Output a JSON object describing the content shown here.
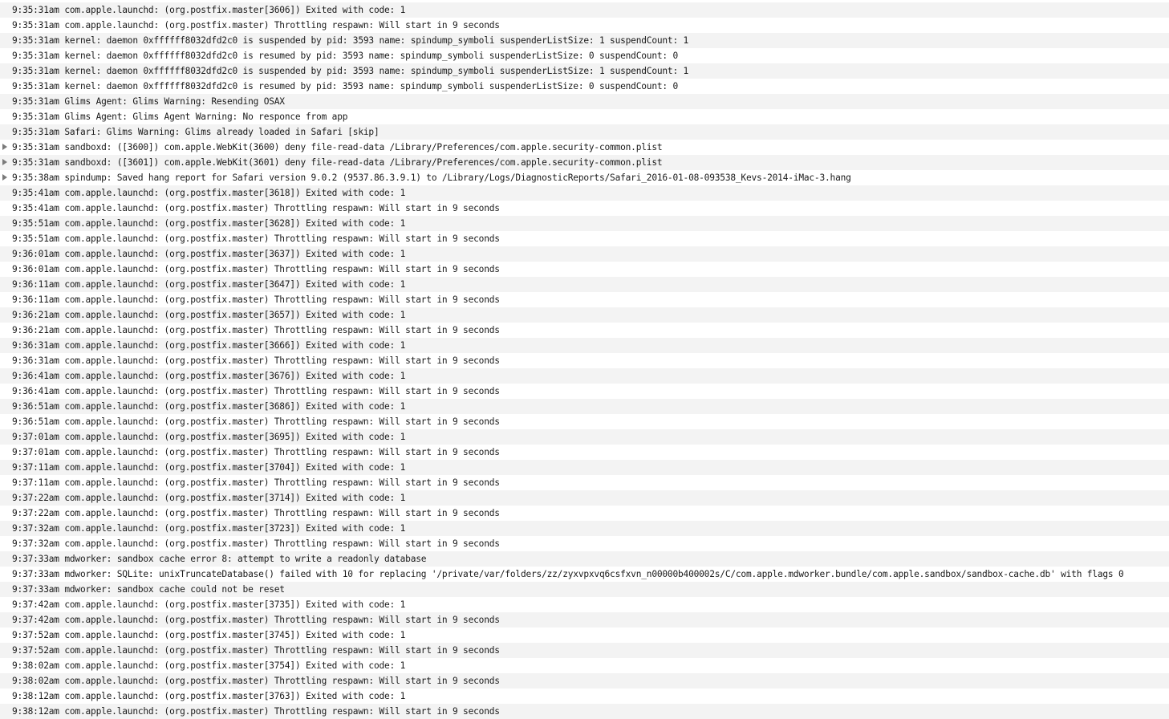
{
  "log_lines": [
    {
      "text": "9:35:31am com.apple.launchd: (org.postfix.master[3606]) Exited with code: 1",
      "expandable": false
    },
    {
      "text": "9:35:31am com.apple.launchd: (org.postfix.master) Throttling respawn: Will start in 9 seconds",
      "expandable": false
    },
    {
      "text": "9:35:31am kernel: daemon 0xffffff8032dfd2c0 is suspended by pid: 3593 name: spindump_symboli suspenderListSize: 1 suspendCount: 1",
      "expandable": false
    },
    {
      "text": "9:35:31am kernel: daemon 0xffffff8032dfd2c0 is resumed by pid: 3593 name: spindump_symboli suspenderListSize: 0 suspendCount: 0",
      "expandable": false
    },
    {
      "text": "9:35:31am kernel: daemon 0xffffff8032dfd2c0 is suspended by pid: 3593 name: spindump_symboli suspenderListSize: 1 suspendCount: 1",
      "expandable": false
    },
    {
      "text": "9:35:31am kernel: daemon 0xffffff8032dfd2c0 is resumed by pid: 3593 name: spindump_symboli suspenderListSize: 0 suspendCount: 0",
      "expandable": false
    },
    {
      "text": "9:35:31am Glims Agent: Glims Warning: Resending OSAX",
      "expandable": false
    },
    {
      "text": "9:35:31am Glims Agent: Glims Agent Warning: No responce from app",
      "expandable": false
    },
    {
      "text": "9:35:31am Safari: Glims Warning: Glims already loaded in Safari [skip]",
      "expandable": false
    },
    {
      "text": "9:35:31am sandboxd: ([3600]) com.apple.WebKit(3600) deny file-read-data /Library/Preferences/com.apple.security-common.plist",
      "expandable": true
    },
    {
      "text": "9:35:31am sandboxd: ([3601]) com.apple.WebKit(3601) deny file-read-data /Library/Preferences/com.apple.security-common.plist",
      "expandable": true
    },
    {
      "text": "9:35:38am spindump: Saved hang report for Safari version 9.0.2 (9537.86.3.9.1) to /Library/Logs/DiagnosticReports/Safari_2016-01-08-093538_Kevs-2014-iMac-3.hang",
      "expandable": true
    },
    {
      "text": "9:35:41am com.apple.launchd: (org.postfix.master[3618]) Exited with code: 1",
      "expandable": false
    },
    {
      "text": "9:35:41am com.apple.launchd: (org.postfix.master) Throttling respawn: Will start in 9 seconds",
      "expandable": false
    },
    {
      "text": "9:35:51am com.apple.launchd: (org.postfix.master[3628]) Exited with code: 1",
      "expandable": false
    },
    {
      "text": "9:35:51am com.apple.launchd: (org.postfix.master) Throttling respawn: Will start in 9 seconds",
      "expandable": false
    },
    {
      "text": "9:36:01am com.apple.launchd: (org.postfix.master[3637]) Exited with code: 1",
      "expandable": false
    },
    {
      "text": "9:36:01am com.apple.launchd: (org.postfix.master) Throttling respawn: Will start in 9 seconds",
      "expandable": false
    },
    {
      "text": "9:36:11am com.apple.launchd: (org.postfix.master[3647]) Exited with code: 1",
      "expandable": false
    },
    {
      "text": "9:36:11am com.apple.launchd: (org.postfix.master) Throttling respawn: Will start in 9 seconds",
      "expandable": false
    },
    {
      "text": "9:36:21am com.apple.launchd: (org.postfix.master[3657]) Exited with code: 1",
      "expandable": false
    },
    {
      "text": "9:36:21am com.apple.launchd: (org.postfix.master) Throttling respawn: Will start in 9 seconds",
      "expandable": false
    },
    {
      "text": "9:36:31am com.apple.launchd: (org.postfix.master[3666]) Exited with code: 1",
      "expandable": false
    },
    {
      "text": "9:36:31am com.apple.launchd: (org.postfix.master) Throttling respawn: Will start in 9 seconds",
      "expandable": false
    },
    {
      "text": "9:36:41am com.apple.launchd: (org.postfix.master[3676]) Exited with code: 1",
      "expandable": false
    },
    {
      "text": "9:36:41am com.apple.launchd: (org.postfix.master) Throttling respawn: Will start in 9 seconds",
      "expandable": false
    },
    {
      "text": "9:36:51am com.apple.launchd: (org.postfix.master[3686]) Exited with code: 1",
      "expandable": false
    },
    {
      "text": "9:36:51am com.apple.launchd: (org.postfix.master) Throttling respawn: Will start in 9 seconds",
      "expandable": false
    },
    {
      "text": "9:37:01am com.apple.launchd: (org.postfix.master[3695]) Exited with code: 1",
      "expandable": false
    },
    {
      "text": "9:37:01am com.apple.launchd: (org.postfix.master) Throttling respawn: Will start in 9 seconds",
      "expandable": false
    },
    {
      "text": "9:37:11am com.apple.launchd: (org.postfix.master[3704]) Exited with code: 1",
      "expandable": false
    },
    {
      "text": "9:37:11am com.apple.launchd: (org.postfix.master) Throttling respawn: Will start in 9 seconds",
      "expandable": false
    },
    {
      "text": "9:37:22am com.apple.launchd: (org.postfix.master[3714]) Exited with code: 1",
      "expandable": false
    },
    {
      "text": "9:37:22am com.apple.launchd: (org.postfix.master) Throttling respawn: Will start in 9 seconds",
      "expandable": false
    },
    {
      "text": "9:37:32am com.apple.launchd: (org.postfix.master[3723]) Exited with code: 1",
      "expandable": false
    },
    {
      "text": "9:37:32am com.apple.launchd: (org.postfix.master) Throttling respawn: Will start in 9 seconds",
      "expandable": false
    },
    {
      "text": "9:37:33am mdworker: sandbox cache error 8: attempt to write a readonly database",
      "expandable": false
    },
    {
      "text": "9:37:33am mdworker: SQLite: unixTruncateDatabase() failed with 10 for replacing '/private/var/folders/zz/zyxvpxvq6csfxvn_n00000b400002s/C/com.apple.mdworker.bundle/com.apple.sandbox/sandbox-cache.db' with flags 0",
      "expandable": false
    },
    {
      "text": "9:37:33am mdworker: sandbox cache could not be reset",
      "expandable": false
    },
    {
      "text": "9:37:42am com.apple.launchd: (org.postfix.master[3735]) Exited with code: 1",
      "expandable": false
    },
    {
      "text": "9:37:42am com.apple.launchd: (org.postfix.master) Throttling respawn: Will start in 9 seconds",
      "expandable": false
    },
    {
      "text": "9:37:52am com.apple.launchd: (org.postfix.master[3745]) Exited with code: 1",
      "expandable": false
    },
    {
      "text": "9:37:52am com.apple.launchd: (org.postfix.master) Throttling respawn: Will start in 9 seconds",
      "expandable": false
    },
    {
      "text": "9:38:02am com.apple.launchd: (org.postfix.master[3754]) Exited with code: 1",
      "expandable": false
    },
    {
      "text": "9:38:02am com.apple.launchd: (org.postfix.master) Throttling respawn: Will start in 9 seconds",
      "expandable": false
    },
    {
      "text": "9:38:12am com.apple.launchd: (org.postfix.master[3763]) Exited with code: 1",
      "expandable": false
    },
    {
      "text": "9:38:12am com.apple.launchd: (org.postfix.master) Throttling respawn: Will start in 9 seconds",
      "expandable": false
    }
  ],
  "icons": {
    "disclosure": "disclosure-triangle-right-icon"
  },
  "colors": {
    "row_stripe": "#f3f3f3",
    "row_plain": "#ffffff",
    "text": "#1a1a1a",
    "disclosure": "#7a7a7a"
  }
}
